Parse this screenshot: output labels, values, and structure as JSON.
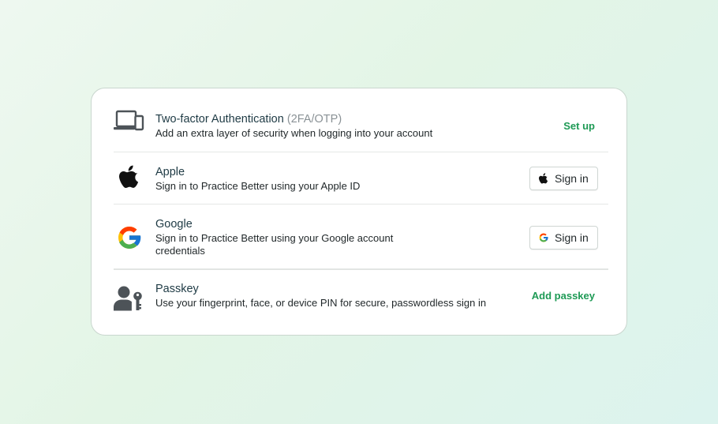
{
  "rows": {
    "two_factor": {
      "icon": "devices-icon",
      "title": "Two-factor Authentication",
      "title_suffix": "(2FA/OTP)",
      "description": "Add an extra layer of security when logging into your account",
      "action_label": "Set up"
    },
    "apple": {
      "icon": "apple-logo-icon",
      "title": "Apple",
      "description": "Sign in to Practice Better using your Apple ID",
      "action_label": "Sign in"
    },
    "google": {
      "icon": "google-logo-icon",
      "title": "Google",
      "description_line1": "Sign in to Practice Better using your Google account",
      "description_line2": "credentials",
      "action_label": "Sign in"
    },
    "passkey": {
      "icon": "user-key-icon",
      "title": "Passkey",
      "description": "Use your fingerprint, face, or device PIN for secure, passwordless sign in",
      "action_label": "Add passkey"
    }
  },
  "colors": {
    "accent": "#1e9a55",
    "title": "#1e3a44",
    "muted": "#8a9296",
    "icon_gray": "#4d5358"
  }
}
